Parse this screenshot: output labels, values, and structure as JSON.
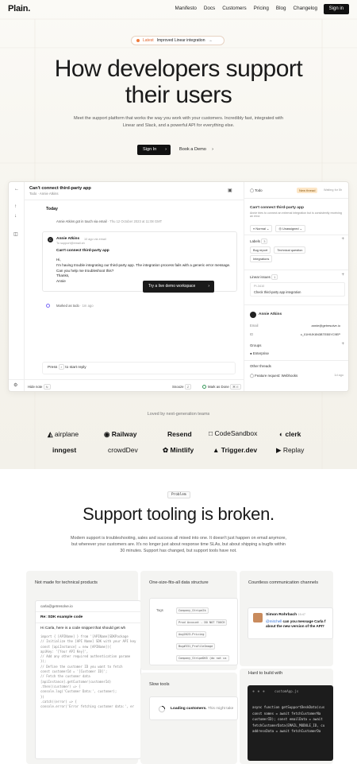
{
  "nav": {
    "logo": "Plain.",
    "links": [
      "Manifesto",
      "Docs",
      "Customers",
      "Pricing",
      "Blog",
      "Changelog"
    ],
    "signin": "Sign in"
  },
  "announcement": {
    "tag": "Latest",
    "text": "Improved Linear integration",
    "arrow": "→"
  },
  "hero": {
    "title_line1": "How developers support",
    "title_line2": "their users",
    "subtitle": "Meet the support platform that works the way you work with your customers. Incredibly fast, integrated with Linear and Slack, and a powerful API for everything else.",
    "primary_cta": "Sign In",
    "secondary_cta": "Book a Demo",
    "arrow": "›"
  },
  "app": {
    "thread_title": "Can't connect third-party app",
    "thread_sub": "Todo · Annie Atkins",
    "today": "Today",
    "event1": "Annie Atkins got in touch via email",
    "event1_time": "· Thu 12 October 2023 at 11:08 GMT",
    "message": {
      "avatar": "C",
      "name": "Annie Atkins",
      "meta": "10 ago via email",
      "to": "To support@email.sh",
      "subject": "Can't connect third-party app",
      "greeting": "Hi,",
      "body": "I'm having trouble integrating our third-party app. The integration process fails with a generic error message. Can you help me troubleshoot this?",
      "signoff": "Thanks,",
      "signature": "Annie"
    },
    "demo_button": "Try a live demo workspace",
    "event2": "Marked as todo",
    "event2_time": "· 1m ago",
    "reply_prefix": "Press",
    "reply_key": "r",
    "reply_suffix": "to start reply",
    "bottom": {
      "note": "Hide note",
      "note_key": "N",
      "snooze": "Snooze",
      "snooze_key": "Z",
      "done": "Mark as Done",
      "done_key": "⌘ E"
    },
    "panel": {
      "status": "Todo",
      "new_thread": "New thread",
      "waiting": "Waiting for 5h",
      "title": "Can't connect third-party app",
      "desc": "Annie tries to connect an external integration but is consistently receiving an error.",
      "priority": "Normal",
      "assignee": "Unassigned",
      "labels_title": "Labels",
      "labels_count": "3",
      "labels": [
        "Bug report",
        "Technical question",
        "Integrations"
      ],
      "linear_title": "Linear issues",
      "linear_count": "1",
      "linear_id": "PI-3410",
      "linear_text": "Check third-party app integration",
      "customer_name": "Annie Atkins",
      "email_label": "Email",
      "email_value": "annie@getresolve.io",
      "id_label": "ID",
      "id_value": "c_01H9JK8N3BTEB5YC9EP",
      "groups_title": "Groups",
      "group": "Enterprise",
      "other_title": "Other threads",
      "other_thread": "Feature request: Webhooks",
      "other_time": "1d ago"
    }
  },
  "logos": {
    "heading": "Loved by next-generation teams",
    "row1": [
      "airplane",
      "Railway",
      "Resend",
      "CodeSandbox",
      "clerk"
    ],
    "row2": [
      "inngest",
      "crowdDev",
      "Mintlify",
      "Trigger.dev",
      "Replay"
    ]
  },
  "problem": {
    "tag": "Problem",
    "title": "Support tooling is broken.",
    "subtitle": "Modern support is troubleshooting, sales and success all mixed into one. It doesn't just happen on email anymore, but wherever your customers are. It's no longer just about response time SLAs, but about shipping a bugfix within 30 minutes. Support has changed, but support tools have not."
  },
  "cards": {
    "card1": {
      "title": "Not made for technical products",
      "from": "carla@getresolve.io",
      "subject": "Re: SDK example code",
      "greeting": "Hi Carla, here is a code snippet that should get wh",
      "code": [
        "import { [APIName] } from '[APIName]SDKPackage",
        "// Initialize the [API Name] SDK with your API key",
        "const [apiInstance] = new [APIName]({",
        "  apiKey: '[Your API Key]',",
        "  // Add any other required authentication parame",
        "});",
        "// Define the customer ID you want to fetch",
        "const customerId = '[Customer ID]';",
        "// Fetch the customer data",
        "[apiInstance].getCustomer(customerId)",
        "  .then((customer) => {",
        "    console.log('Customer Data:', customer);",
        "  })",
        "  .catch((error) => {",
        "    console.error('Error fetching customer data:', er"
      ]
    },
    "card2": {
      "title": "One-size-fits-all data structure",
      "tags_label": "Tags",
      "tags": [
        "Company_Stripe2k",
        "Prod Account - DO NOT TOUCH",
        "Aug2023-Pricing",
        "Bug#331_ProfileImage",
        "Company_StripeDK5 (do not us"
      ]
    },
    "card3": {
      "title": "Slow tools",
      "loading": "Loading customers.",
      "loading_more": "This might take"
    },
    "card4": {
      "title": "Countless communication channels",
      "sender": "Simon Rohrbach",
      "time": "15:47",
      "mention": "@mitchell",
      "message": "can you message Carla f about the new version of the API?"
    },
    "card5": {
      "title": "Hard to build with",
      "file": "customApp.js",
      "code": [
        "async function getSupportDeskData(cus",
        "  const names = await fetchCustomerNa",
        "  customerID); const emailData = await",
        "  fetchCustomerData(EMAIL_MODULE_ID, cu",
        "  addressData = await fetchCustomerDa"
      ]
    }
  }
}
